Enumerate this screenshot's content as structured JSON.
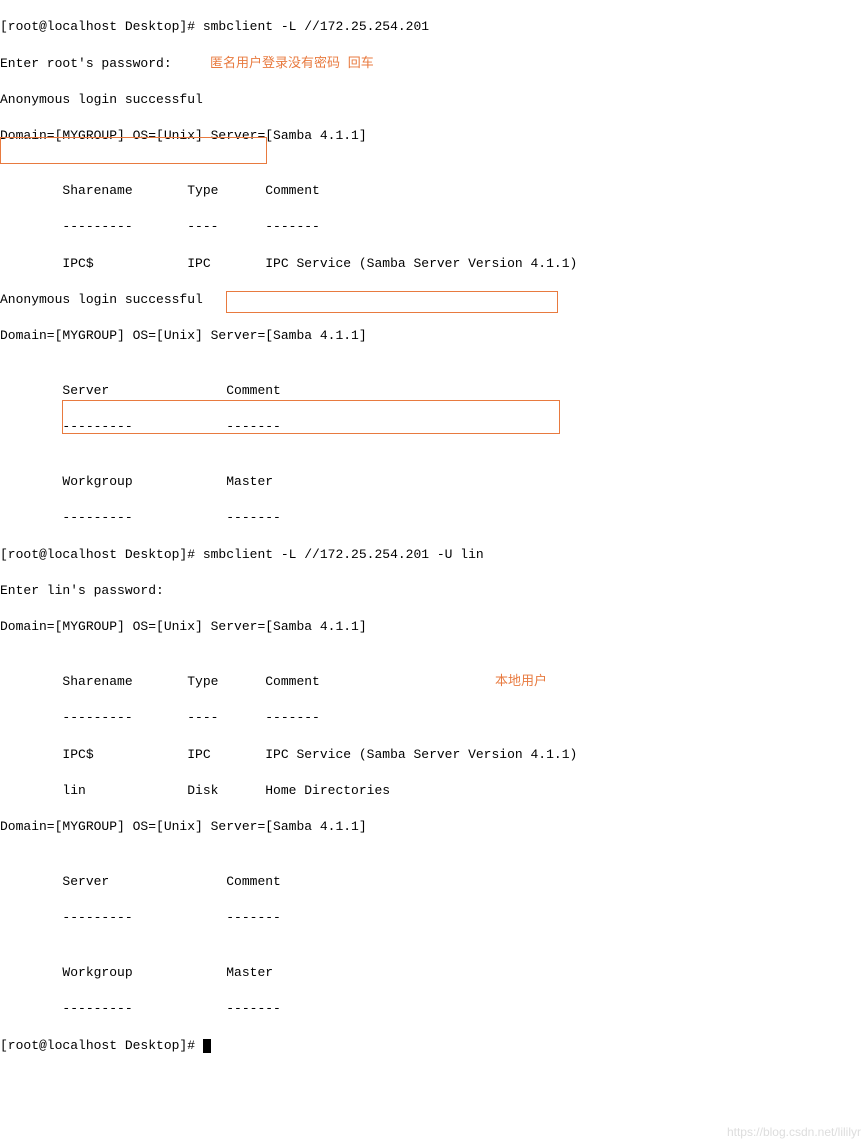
{
  "lines": {
    "l1": "[root@localhost Desktop]# smbclient -L //172.25.254.201",
    "l2": "Enter root's password: ",
    "l3": "Anonymous login successful",
    "l4": "Domain=[MYGROUP] OS=[Unix] Server=[Samba 4.1.1]",
    "l5": "",
    "l6": "        Sharename       Type      Comment",
    "l7": "        ---------       ----      -------",
    "l8": "        IPC$            IPC       IPC Service (Samba Server Version 4.1.1)",
    "l9": "Anonymous login successful",
    "l10": "Domain=[MYGROUP] OS=[Unix] Server=[Samba 4.1.1]",
    "l11": "",
    "l12": "        Server               Comment",
    "l13": "        ---------            -------",
    "l14": "",
    "l15": "        Workgroup            Master",
    "l16": "        ---------            -------",
    "l17": "[root@localhost Desktop]# smbclient -L //172.25.254.201 -U lin",
    "l18": "Enter lin's password: ",
    "l19": "Domain=[MYGROUP] OS=[Unix] Server=[Samba 4.1.1]",
    "l20": "",
    "l21": "        Sharename       Type      Comment",
    "l22": "        ---------       ----      -------",
    "l23": "        IPC$            IPC       IPC Service (Samba Server Version 4.1.1)",
    "l24": "        lin             Disk      Home Directories",
    "l25": "Domain=[MYGROUP] OS=[Unix] Server=[Samba 4.1.1]",
    "l26": "",
    "l27": "        Server               Comment",
    "l28": "        ---------            -------",
    "l29": "",
    "l30": "        Workgroup            Master",
    "l31": "        ---------            -------",
    "l32": "[root@localhost Desktop]# "
  },
  "annotations": {
    "anon_note": "匿名用户登录没有密码 回车",
    "local_user": "本地用户"
  },
  "watermark": "https://blog.csdn.net/lililyr"
}
